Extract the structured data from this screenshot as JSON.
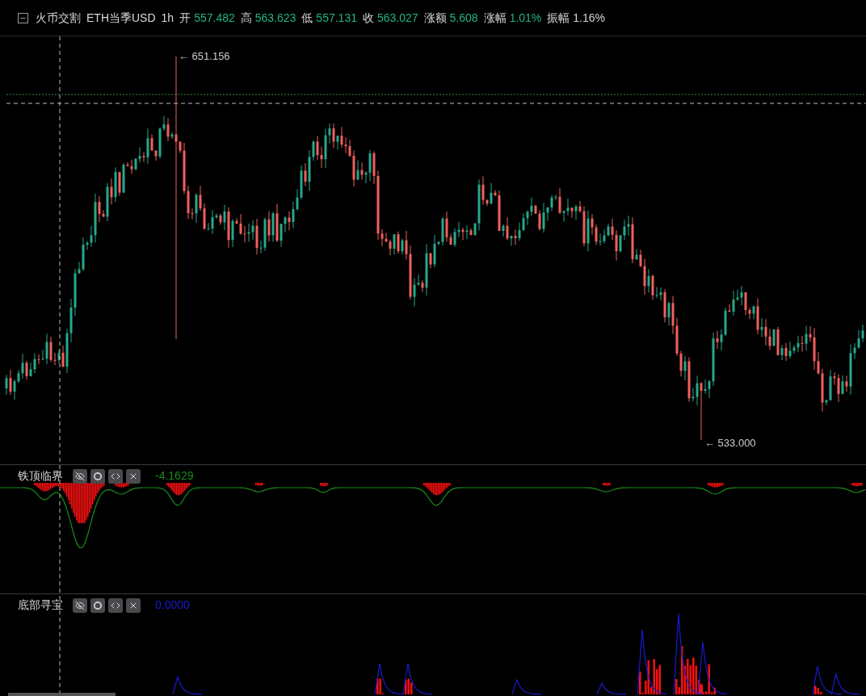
{
  "header": {
    "exchange": "火币交割",
    "symbol": "ETH当季USD",
    "interval": "1h",
    "fields": [
      {
        "label": "开",
        "value": "557.482",
        "color": "#22b482"
      },
      {
        "label": "高",
        "value": "563.623",
        "color": "#22b482"
      },
      {
        "label": "低",
        "value": "557.131",
        "color": "#22b482"
      },
      {
        "label": "收",
        "value": "563.027",
        "color": "#22b482"
      },
      {
        "label": "涨额",
        "value": "5.608",
        "color": "#22b482"
      },
      {
        "label": "涨幅",
        "value": "1.01%",
        "color": "#22b482"
      },
      {
        "label": "振幅",
        "value": "1.16%",
        "color": "#d4d4d4"
      }
    ]
  },
  "main_chart": {
    "high_marker": "← 651.156",
    "low_marker": "← 533.000"
  },
  "indicators": [
    {
      "kind": "top",
      "name": "铁顶临界",
      "value": "-4.1629",
      "color": "#1a8c1a"
    },
    {
      "kind": "bottom",
      "name": "底部寻宝",
      "value": "0.0000",
      "color": "#1a1ad2"
    }
  ]
}
